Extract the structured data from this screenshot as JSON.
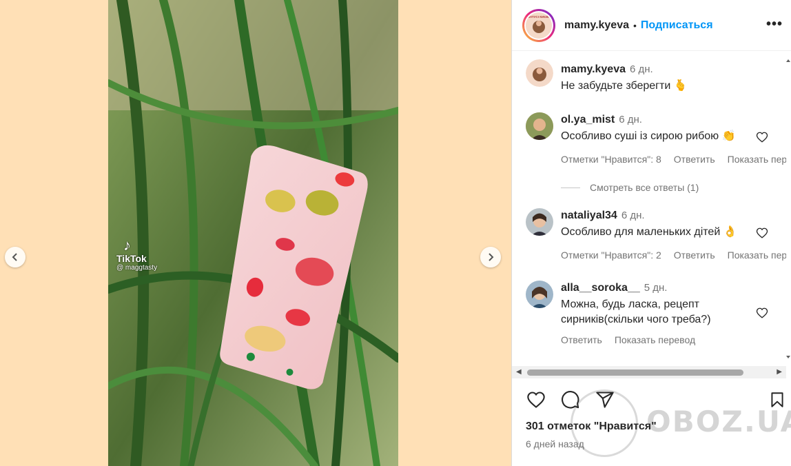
{
  "header": {
    "username": "mamy.kyeva",
    "separator": "•",
    "follow_label": "Подписаться",
    "more_label": "•••",
    "avatar_logo_text": "МАТУСІ КИЄВА"
  },
  "video": {
    "tiktok_label": "TikTok",
    "tiktok_handle": "@ maggtasty"
  },
  "comments": [
    {
      "username": "mamy.kyeva",
      "time": "6 дн.",
      "text": "Не забудьте зберегти 🫰"
    },
    {
      "username": "ol.ya_mist",
      "time": "6 дн.",
      "text": "Особливо суші із сирою рибою 👏",
      "likes_label": "Отметки \"Нравится\": 8",
      "reply_label": "Ответить",
      "translate_label": "Показать перевод"
    },
    {
      "username": "nataliyal34",
      "time": "6 дн.",
      "text": "Особливо для маленьких дітей 👌",
      "likes_label": "Отметки \"Нравится\": 2",
      "reply_label": "Ответить",
      "translate_label": "Показать перевод"
    },
    {
      "username": "alla__soroka__",
      "time": "5 дн.",
      "text_line1": "Можна, будь ласка, рецепт",
      "text_line2": "сирників(скільки чого треба?)",
      "reply_label": "Ответить",
      "translate_label": "Показать перевод"
    }
  ],
  "view_replies": "Смотреть все ответы (1)",
  "footer": {
    "likes": "301 отметок \"Нравится\"",
    "time": "6 дней назад"
  },
  "watermark": "OBOZ.UA"
}
